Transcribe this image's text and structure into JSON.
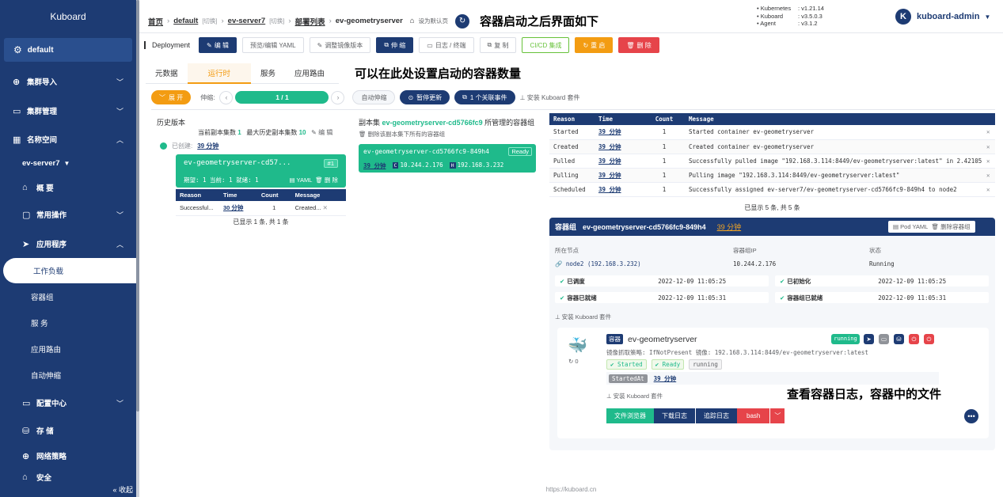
{
  "sidebar": {
    "brand": "Kuboard",
    "namespace": "default",
    "items": {
      "cluster_import": "集群导入",
      "cluster_manage": "集群管理",
      "namespaces": "名称空间",
      "ns_name": "ev-server7",
      "overview": "概 要",
      "common_ops": "常用操作",
      "apps": "应用程序",
      "workloads": "工作负载",
      "pods": "容器组",
      "services": "服 务",
      "ingress": "应用路由",
      "autoscale": "自动伸缩",
      "config": "配置中心",
      "storage": "存 储",
      "netpolicy": "网络策略",
      "security": "安全"
    },
    "collapse": "« 收起"
  },
  "header": {
    "home": "首页",
    "cluster": "default",
    "switch": "[切换]",
    "namespace": "ev-server7",
    "list": "部署列表",
    "workload": "ev-geometryserver",
    "set_default": "设为默认页",
    "annotation": "容器启动之后界面如下",
    "versions": [
      {
        "k": "Kubernetes",
        "v": ": v1.21.14"
      },
      {
        "k": "Kuboard",
        "v": ": v3.5.0.3"
      },
      {
        "k": "Agent",
        "v": ": v3.1.2"
      }
    ],
    "user_initial": "K",
    "user": "kuboard-admin"
  },
  "toolbar": {
    "label": "Deployment",
    "edit": "编 辑",
    "preview_yaml": "预览/编辑 YAML",
    "adjust_image": "调整镜像版本",
    "scale": "伸 缩",
    "logs": "日志 / 终端",
    "copy": "复 制",
    "cicd": "CI/CD 集成",
    "restart": "重 启",
    "delete": "删 除"
  },
  "tabs": {
    "meta": "元数据",
    "runtime": "运行时",
    "service": "服务",
    "ingress": "应用路由",
    "annotation": "可以在此处设置启动的容器数量"
  },
  "actions": {
    "expand": "展 开",
    "scale_label": "伸缩:",
    "replicas": "1 / 1",
    "auto_scale": "自动伸缩",
    "pause": "暂停更新",
    "related": "1 个关联事件",
    "install_suite": "安装 Kuboard 套件"
  },
  "history": {
    "title": "历史版本",
    "current_label": "当前副本集数",
    "current": "1",
    "max_label": "最大历史副本集数",
    "max": "10",
    "edit": "编 辑",
    "created_label": "已创建:",
    "created": "39 分钟",
    "rs_name": "ev-geometryserver-cd57...",
    "rs_tag": "#1",
    "rs_status": "期望: 1  当前: 1  就绪: 1",
    "yaml": "YAML",
    "delete": "删 除",
    "headers": [
      "Reason",
      "Time",
      "Count",
      "Message"
    ],
    "rows": [
      {
        "reason": "Successful...",
        "time": "30 分钟",
        "count": "1",
        "message": "Created..."
      }
    ],
    "footer": "已显示 1 条, 共 1 条"
  },
  "pods": {
    "title_prefix": "副本集",
    "rs": "ev-geometryserver-cd5766fc9",
    "title_suffix": "所管理的容器组",
    "delete_all": "删除该副本集下所有的容器组",
    "pod_name": "ev-geometryserver-cd5766fc9-849h4",
    "ready": "Ready",
    "time": "39 分钟",
    "pod_ip": "10.244.2.176",
    "host_ip": "192.168.3.232"
  },
  "events": {
    "headers": [
      "Reason",
      "Time",
      "Count",
      "Message"
    ],
    "rows": [
      {
        "reason": "Started",
        "time": "39 分钟",
        "count": "1",
        "message": "Started container ev-geometryserver"
      },
      {
        "reason": "Created",
        "time": "39 分钟",
        "count": "1",
        "message": "Created container ev-geometryserver"
      },
      {
        "reason": "Pulled",
        "time": "39 分钟",
        "count": "1",
        "message": "Successfully pulled image \"192.168.3.114:8449/ev-geometryserver:latest\" in 2.4210518..."
      },
      {
        "reason": "Pulling",
        "time": "39 分钟",
        "count": "1",
        "message": "Pulling image \"192.168.3.114:8449/ev-geometryserver:latest\""
      },
      {
        "reason": "Scheduled",
        "time": "39 分钟",
        "count": "1",
        "message": "Successfully assigned ev-server7/ev-geometryserver-cd5766fc9-849h4 to node2"
      }
    ],
    "footer": "已显示 5 条, 共 5 条"
  },
  "pod_detail": {
    "label": "容器组",
    "name": "ev-geometryserver-cd5766fc9-849h4",
    "time": "39 分钟",
    "pod_yaml": "Pod YAML",
    "delete_pod": "删除容器组",
    "node_label": "所在节点",
    "node": "node2 (192.168.3.232)",
    "ip_label": "容器组IP",
    "ip": "10.244.2.176",
    "status_label": "状态",
    "status": "Running",
    "conditions": [
      {
        "name": "已调度",
        "time": "2022-12-09 11:05:25"
      },
      {
        "name": "已初始化",
        "time": "2022-12-09 11:05:25"
      },
      {
        "name": "容器已就绪",
        "time": "2022-12-09 11:05:31"
      },
      {
        "name": "容器组已就绪",
        "time": "2022-12-09 11:05:31"
      }
    ],
    "install_suite": "安装 Kuboard 套件"
  },
  "container": {
    "tag": "容器",
    "name": "ev-geometryserver",
    "state": "running",
    "restart": "0",
    "policy": "镜像抓取策略: IfNotPresent   镜像: 192.168.3.114:8449/ev-geometryserver:latest",
    "started": "Started",
    "ready": "Ready",
    "running": "running",
    "started_at_label": "StartedAt",
    "started_at": "39 分钟",
    "install_suite": "安装 Kuboard 套件",
    "file_browser": "文件浏览器",
    "download_logs": "下载日志",
    "trace_logs": "追踪日志",
    "bash": "bash",
    "annotation": "查看容器日志，容器中的文件"
  },
  "footer": "https://kuboard.cn"
}
